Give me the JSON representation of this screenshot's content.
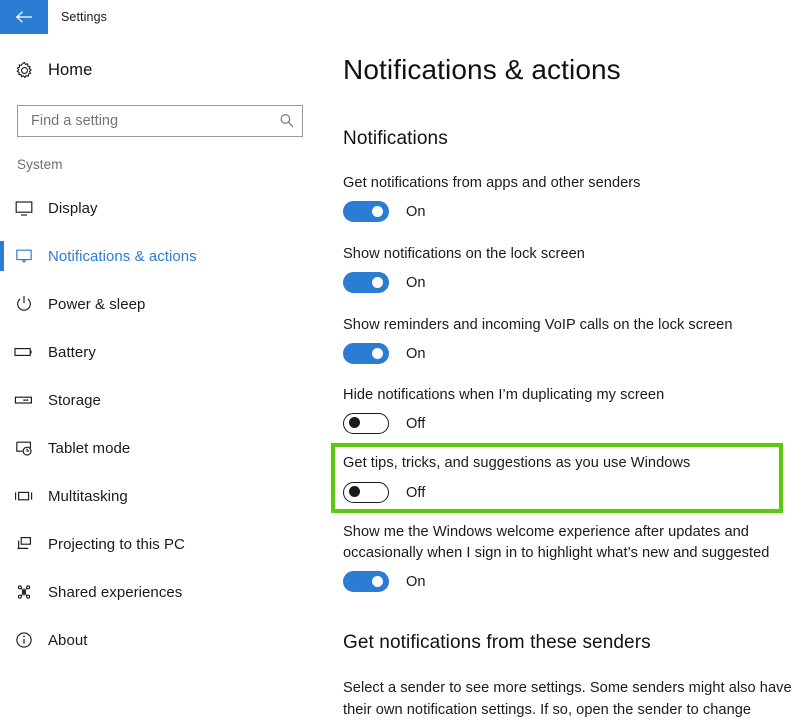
{
  "titlebar": {
    "back_icon": "back-arrow-icon",
    "title": "Settings",
    "accent_color": "#2B7CD3"
  },
  "sidebar": {
    "home": {
      "icon": "gear-icon",
      "label": "Home"
    },
    "search": {
      "value": "",
      "placeholder": "Find a setting",
      "icon": "search-icon"
    },
    "group_label": "System",
    "items": [
      {
        "label": "Display",
        "icon": "monitor-icon",
        "selected": false
      },
      {
        "label": "Notifications & actions",
        "icon": "notification-balloon-icon",
        "selected": true
      },
      {
        "label": "Power & sleep",
        "icon": "power-icon",
        "selected": false
      },
      {
        "label": "Battery",
        "icon": "battery-icon",
        "selected": false
      },
      {
        "label": "Storage",
        "icon": "drive-icon",
        "selected": false
      },
      {
        "label": "Tablet mode",
        "icon": "tablet-touch-icon",
        "selected": false
      },
      {
        "label": "Multitasking",
        "icon": "multitask-window-icon",
        "selected": false
      },
      {
        "label": "Projecting to this PC",
        "icon": "project-screen-icon",
        "selected": false
      },
      {
        "label": "Shared experiences",
        "icon": "share-nodes-icon",
        "selected": false
      },
      {
        "label": "About",
        "icon": "info-circle-icon",
        "selected": false
      }
    ]
  },
  "main": {
    "page_title": "Notifications & actions",
    "notifications_heading": "Notifications",
    "settings": [
      {
        "label": "Get notifications from apps and other senders",
        "state": "On",
        "on": true
      },
      {
        "label": "Show notifications on the lock screen",
        "state": "On",
        "on": true
      },
      {
        "label": "Show reminders and incoming VoIP calls on the lock screen",
        "state": "On",
        "on": true
      },
      {
        "label": "Hide notifications when I’m duplicating my screen",
        "state": "Off",
        "on": false
      },
      {
        "label": "Get tips, tricks, and suggestions as you use Windows",
        "state": "Off",
        "on": false,
        "highlighted": true
      },
      {
        "label": "Show me the Windows welcome experience after updates and occasionally when I sign in to highlight what’s new and suggested",
        "state": "On",
        "on": true
      }
    ],
    "senders_heading": "Get notifications from these senders",
    "senders_description": "Select a sender to see more settings. Some senders might also have their own notification settings. If so, open the sender to change"
  },
  "annotation": {
    "highlight_color": "#5CC813",
    "target": "Get tips, tricks, and suggestions as you use Windows"
  }
}
